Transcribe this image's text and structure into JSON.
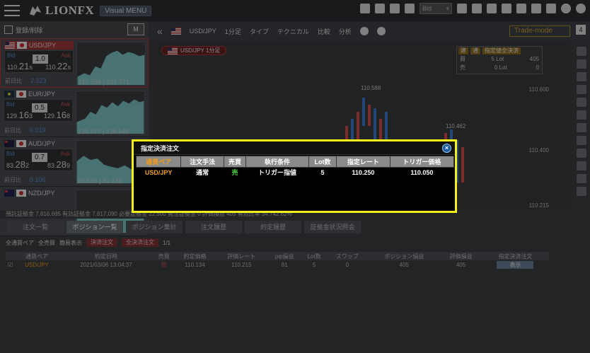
{
  "app": {
    "logo": "LIONFX",
    "visual_menu": "Visual MENU",
    "rate_type": "Bid"
  },
  "left_panel": {
    "register_label": "登録/削除",
    "m_button": "M",
    "pairs": [
      {
        "pair": "USD/JPY",
        "spread": "1.0",
        "bid_small": "110.",
        "bid_big": "21",
        "bid_last": "s",
        "ask_small": "110.",
        "ask_big": "22",
        "ask_last": "s",
        "prev_label": "前日比",
        "change": "2.323",
        "high_low": "110.588 | 107.771"
      },
      {
        "pair": "EUR/JPY",
        "spread": "0.5",
        "bid_small": "129.",
        "bid_big": "16",
        "bid_last": "3",
        "ask_small": "129.",
        "ask_big": "16",
        "ask_last": "8",
        "prev_label": "前日比",
        "change": "0.019",
        "high_low": "129.577 | 128.548"
      },
      {
        "pair": "AUD/JPY",
        "spread": "0.7",
        "bid_small": "83.",
        "bid_big": "28",
        "bid_last": "2",
        "ask_small": "83.",
        "ask_big": "28",
        "ask_last": "9",
        "prev_label": "前日比",
        "change": "0.106",
        "high_low": "83.590 | 82.745"
      },
      {
        "pair": "NZD/JPY",
        "spread": "",
        "bid_small": "",
        "bid_big": "",
        "bid_last": "",
        "ask_small": "",
        "ask_big": "",
        "ask_last": "",
        "prev_label": "",
        "change": "",
        "high_low": ""
      }
    ]
  },
  "chart_toolbar": {
    "pair": "USD/JPY",
    "timeframe": "1分足",
    "type": "タイプ",
    "technical": "テクニカル",
    "compare": "比較",
    "analysis": "分析",
    "trade_mode": "Trade-mode",
    "page": "4"
  },
  "chart": {
    "tag": "USD/JPY 1分足",
    "peak_high": "110.588",
    "peak_mid": "110.462",
    "y_top": "110.600",
    "y_mid": "110.400",
    "y_bottom": "110.215"
  },
  "position_box": {
    "tag1": "建",
    "tag2": "通",
    "tag3": "指定値全決済",
    "buy_label": "買",
    "buy_lot": "5 Lot",
    "buy_val": "405",
    "sell_label": "売",
    "sell_lot": "0 Lot",
    "sell_val": "0"
  },
  "summary": "預託証拠金 7,816,685 有効証拠金 7,817,090 必要証拠金 22,500 発注証拠金 0 評価損益 405 有効比率 34,742.62%",
  "tabs": [
    "注文一覧",
    "ポジション一覧",
    "ポジション集計",
    "注文履歴",
    "約定履歴",
    "証拠金状況照会"
  ],
  "filters": {
    "all_pairs": "全通貨ペア",
    "all_side": "全売買",
    "summary_toggle": "簡易表示",
    "settle_button": "決済注文",
    "all_settle_button": "全決済注文",
    "page": "1/1"
  },
  "positions": {
    "headers": [
      "",
      "通貨ペア",
      "約定日時",
      "売買",
      "約定価格",
      "評価レート",
      "pip損益",
      "Lot数",
      "スワップ",
      "ポジション損益",
      "評価損益",
      "指定決済注文"
    ],
    "rows": [
      [
        "☑",
        "USD/JPY",
        "2021/03/06 13:04:37",
        "買",
        "110.134",
        "110.215",
        "81",
        "5",
        "0",
        "405",
        "405",
        "表示"
      ]
    ]
  },
  "modal": {
    "title": "指定決済注文",
    "headers": [
      "通貨ペア",
      "注文手法",
      "売買",
      "執行条件",
      "Lot数",
      "指定レート",
      "トリガー価格"
    ],
    "row": [
      "USD/JPY",
      "通常",
      "売",
      "トリガー指値",
      "5",
      "110.250",
      "110.050"
    ]
  },
  "colors": {
    "modal_border": "#f4ef15",
    "pair_orange": "#f09c1a",
    "sell_green": "#4cd13f",
    "close_blue": "#1c5d9e"
  }
}
